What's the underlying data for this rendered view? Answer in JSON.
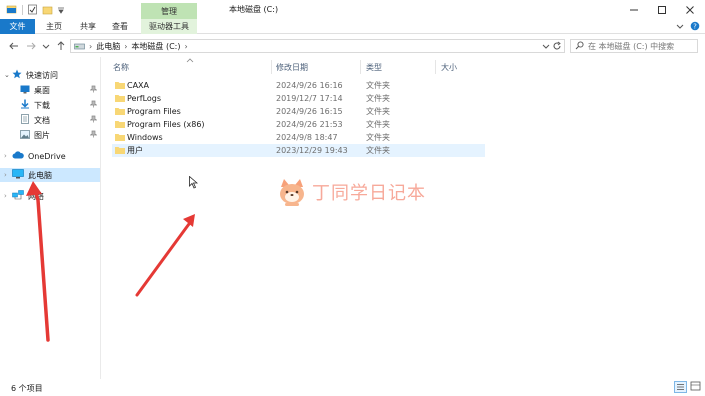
{
  "window": {
    "title": "本地磁盘 (C:)",
    "minimize": "—",
    "maximize": "☐",
    "close": "✕"
  },
  "ribbon": {
    "tabs": {
      "file": "文件",
      "home": "主页",
      "share": "共享",
      "view": "查看",
      "drive_tools": "驱动器工具"
    },
    "contextual_header": "管理"
  },
  "address": {
    "path_root": "此电脑",
    "path_drive": "本地磁盘 (C:)",
    "search_placeholder": "在 本地磁盘 (C:) 中搜索"
  },
  "navpane": {
    "quick_access": "快速访问",
    "items": [
      {
        "label": "桌面",
        "pinned": true
      },
      {
        "label": "下载",
        "pinned": true
      },
      {
        "label": "文档",
        "pinned": true
      },
      {
        "label": "图片",
        "pinned": true
      }
    ],
    "onedrive": "OneDrive",
    "this_pc": "此电脑",
    "network": "网络"
  },
  "columns": {
    "name": "名称",
    "modified": "修改日期",
    "type": "类型",
    "size": "大小"
  },
  "files": [
    {
      "name": "CAXA",
      "modified": "2024/9/26 16:16",
      "type": "文件夹"
    },
    {
      "name": "PerfLogs",
      "modified": "2019/12/7 17:14",
      "type": "文件夹"
    },
    {
      "name": "Program Files",
      "modified": "2024/9/26 16:15",
      "type": "文件夹"
    },
    {
      "name": "Program Files (x86)",
      "modified": "2024/9/26 21:53",
      "type": "文件夹"
    },
    {
      "name": "Windows",
      "modified": "2024/9/8 18:47",
      "type": "文件夹"
    },
    {
      "name": "用户",
      "modified": "2023/12/29 19:43",
      "type": "文件夹"
    }
  ],
  "status": {
    "item_count": "6 个项目"
  },
  "watermark": "丁同学日记本",
  "colors": {
    "accent": "#1979ca",
    "selected": "#cce8ff",
    "hover": "#e5f3ff",
    "folder": "#f8d775",
    "annotation_arrow": "#e53935"
  }
}
